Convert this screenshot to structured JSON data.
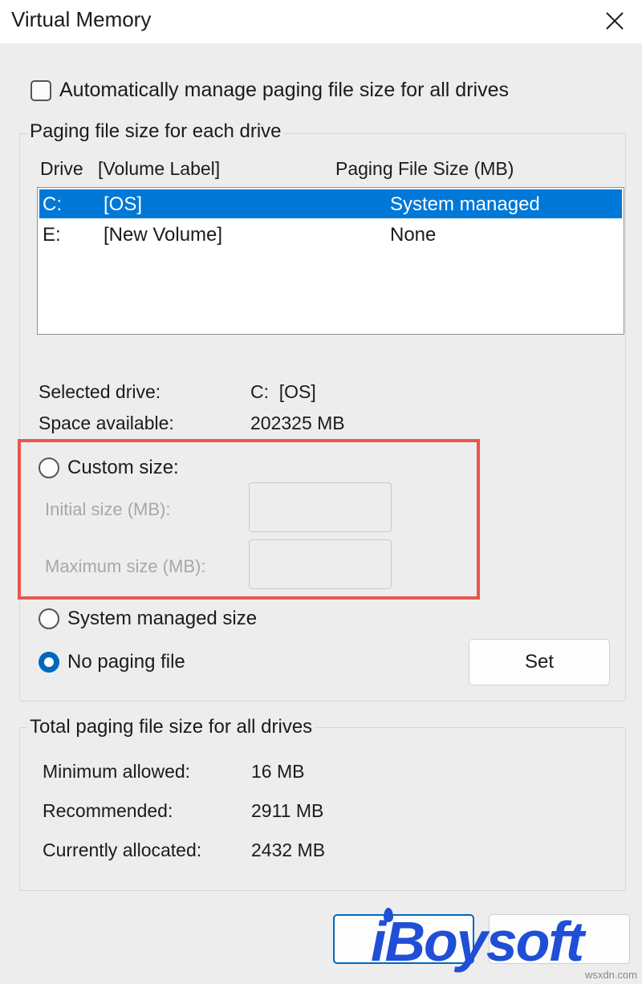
{
  "window": {
    "title": "Virtual Memory",
    "close_icon": "close-icon"
  },
  "auto_manage": {
    "label": "Automatically manage paging file size for all drives",
    "checked": false
  },
  "paging_group": {
    "title": "Paging file size for each drive",
    "columns": [
      "Drive",
      "[Volume Label]",
      "Paging File Size (MB)"
    ],
    "drives": [
      {
        "drive": "C:",
        "label": "[OS]",
        "size": "System managed",
        "selected": true
      },
      {
        "drive": "E:",
        "label": "[New Volume]",
        "size": "None",
        "selected": false
      }
    ],
    "selected_drive_label": "Selected drive:",
    "selected_drive_value": "C:  [OS]",
    "space_available_label": "Space available:",
    "space_available_value": "202325 MB",
    "custom_size_label": "Custom size:",
    "initial_size_label": "Initial size (MB):",
    "initial_size_value": "",
    "maximum_size_label": "Maximum size (MB):",
    "maximum_size_value": "",
    "system_managed_label": "System managed size",
    "no_paging_label": "No paging file",
    "selected_option": "No paging file",
    "set_button": "Set",
    "highlight_color": "#e8564c"
  },
  "totals_group": {
    "title": "Total paging file size for all drives",
    "minimum_label": "Minimum allowed:",
    "minimum_value": "16 MB",
    "recommended_label": "Recommended:",
    "recommended_value": "2911 MB",
    "allocated_label": "Currently allocated:",
    "allocated_value": "2432 MB"
  },
  "watermark": {
    "brand": "iBoysoft",
    "site": "wsxdn.com"
  },
  "colors": {
    "accent": "#0067c0",
    "selection": "#0078d7",
    "watermark": "#1f4fd6"
  }
}
